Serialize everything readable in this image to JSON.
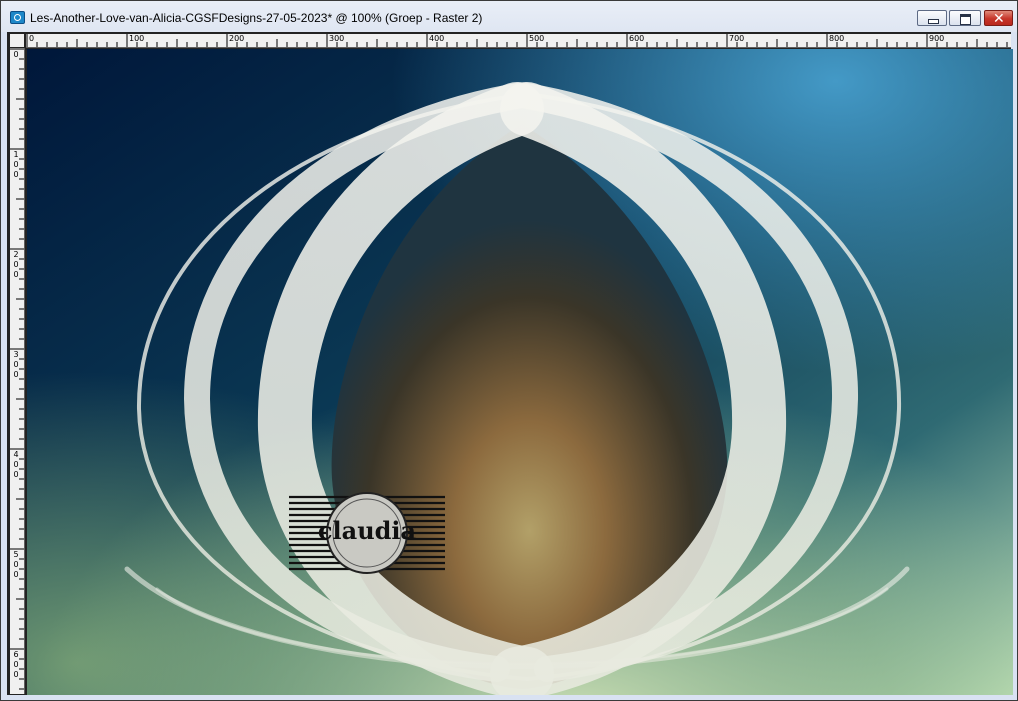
{
  "window": {
    "title": "Les-Another-Love-van-Alicia-CGSFDesigns-27-05-2023* @ 100% (Groep - Raster 2)",
    "icon": "paintshop-pro-icon",
    "controls": {
      "minimize_icon": "minimize-icon",
      "maximize_icon": "restore-icon",
      "close_icon": "close-icon"
    }
  },
  "ruler": {
    "horizontal_labels": [
      "0",
      "100",
      "200",
      "300",
      "400",
      "500",
      "600",
      "700",
      "800",
      "900"
    ],
    "vertical_labels": [
      "0",
      "100",
      "200",
      "300",
      "400",
      "500",
      "600"
    ]
  },
  "artwork": {
    "watermark_text": "claudia",
    "colors": {
      "top_left": "#001a3f",
      "top_right": "#2a7fb3",
      "center": "#8c6f45",
      "bottom": "#a8d2a8",
      "rings": "#e9ebe6"
    }
  }
}
